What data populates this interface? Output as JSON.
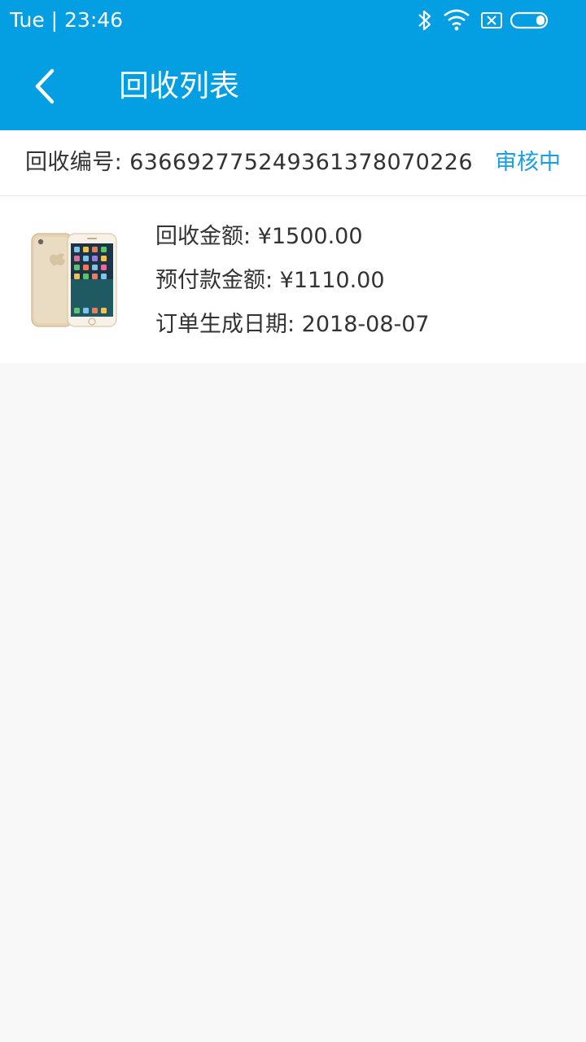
{
  "status_bar": {
    "time": "Tue | 23:46",
    "icons": [
      "bluetooth-icon",
      "wifi-icon",
      "no-sim-icon",
      "battery-icon"
    ]
  },
  "app_bar": {
    "title": "回收列表",
    "back_icon": "chevron-left-icon"
  },
  "order": {
    "number_label": "回收编号: 636692775249361378070226",
    "status": "审核中",
    "product_image": "gold-iphone",
    "lines": {
      "recycle_amount": "回收金额: ¥1500.00",
      "prepay_amount": "预付款金额: ¥1110.00",
      "order_date": "订单生成日期: 2018-08-07"
    }
  },
  "colors": {
    "primary": "#049fe2",
    "status_text": "#1a9fe0",
    "body_text": "#333333",
    "background": "#f8f8f8"
  }
}
